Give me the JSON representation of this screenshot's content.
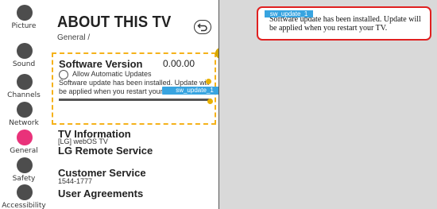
{
  "nav": {
    "items": [
      {
        "label": "Picture",
        "icon": "picture-icon"
      },
      {
        "label": "Sound",
        "icon": "sound-icon"
      },
      {
        "label": "Channels",
        "icon": "channels-icon"
      },
      {
        "label": "Network",
        "icon": "network-icon"
      },
      {
        "label": "General",
        "icon": "general-icon",
        "active": true
      },
      {
        "label": "Safety",
        "icon": "safety-icon"
      },
      {
        "label": "Accessibility",
        "icon": "accessibility-icon"
      }
    ],
    "active_color": "#e9327a"
  },
  "header": {
    "title": "ABOUT THIS TV",
    "breadcrumb": "General /"
  },
  "software": {
    "label": "Software Version",
    "version": "0.00.00",
    "auto_update_label": "Allow Automatic Updates",
    "auto_update_checked": false,
    "message": "Software update has been installed. Update will be applied when you restart your TV.",
    "progress_fraction": 1.0
  },
  "items": [
    {
      "title": "TV Information",
      "subtitle": "[LG] webOS TV"
    },
    {
      "title": "LG Remote Service",
      "subtitle": ""
    },
    {
      "title": "Customer Service",
      "subtitle": "1544-1777"
    },
    {
      "title": "User Agreements",
      "subtitle": ""
    }
  ],
  "markers": {
    "m1": "1",
    "m13": "1-3",
    "m12": "1-2"
  },
  "tooltip": {
    "label": "sw_update_1"
  },
  "notice": {
    "tag": "sw_update_1",
    "message": "Software update has been installed. Update will be applied when you restart your TV.",
    "border_color": "#e02020"
  },
  "colors": {
    "highlight": "#f5b21b",
    "tag": "#38a4e0"
  }
}
